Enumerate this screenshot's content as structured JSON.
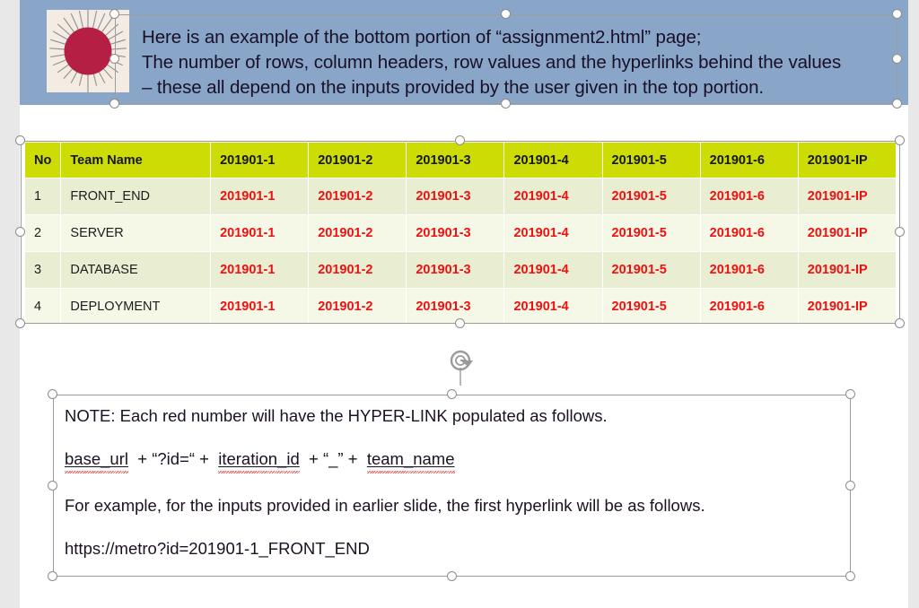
{
  "slide": {
    "background_color": "#ffffff",
    "edge_color": "#e8e8e8"
  },
  "header": {
    "band_color": "#89a5c8",
    "logo": {
      "name": "rising-sun-image",
      "disc_color": "#b51f43",
      "ray_color": "#8f8f95",
      "background_color": "#f4ece2"
    },
    "lines": [
      "Here is an example of the bottom portion of “assignment2.html” page;",
      "The number of rows, column headers, row values and the hyperlinks behind the values",
      "– these all depend on the inputs provided by the user given in the top portion."
    ]
  },
  "table": {
    "header_bg": "#cddc05",
    "row_odd_bg": "#e9edd2",
    "row_even_bg": "#f5f7e7",
    "link_color": "#ee1111",
    "columns": [
      "No",
      "Team Name",
      "201901-1",
      "201901-2",
      "201901-3",
      "201901-4",
      "201901-5",
      "201901-6",
      "201901-IP"
    ],
    "rows": [
      {
        "no": "1",
        "team": "FRONT_END",
        "values": [
          "201901-1",
          "201901-2",
          "201901-3",
          "201901-4",
          "201901-5",
          "201901-6",
          "201901-IP"
        ]
      },
      {
        "no": "2",
        "team": "SERVER",
        "values": [
          "201901-1",
          "201901-2",
          "201901-3",
          "201901-4",
          "201901-5",
          "201901-6",
          "201901-IP"
        ]
      },
      {
        "no": "3",
        "team": "DATABASE",
        "values": [
          "201901-1",
          "201901-2",
          "201901-3",
          "201901-4",
          "201901-5",
          "201901-6",
          "201901-IP"
        ]
      },
      {
        "no": "4",
        "team": "DEPLOYMENT",
        "values": [
          "201901-1",
          "201901-2",
          "201901-3",
          "201901-4",
          "201901-5",
          "201901-6",
          "201901-IP"
        ]
      }
    ]
  },
  "note": {
    "line1": "NOTE:  Each red number will have the HYPER-LINK populated as follows.",
    "formula": {
      "base_url": "base_url",
      "plus1": "+ “?id=“ +",
      "iteration_id": "iteration_id",
      "plus2": "+ “_” +",
      "team_name": "team_name"
    },
    "line3": "For example, for the inputs provided in earlier slide, the first hyperlink will be as follows.",
    "line4": "https://metro?id=201901-1_FRONT_END"
  },
  "icons": {
    "rotate_handle": "rotate-handle-icon"
  }
}
